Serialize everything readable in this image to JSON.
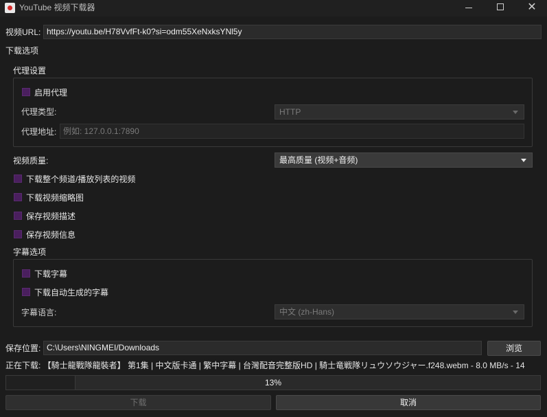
{
  "window": {
    "title": "YouTube 视频下载器"
  },
  "url": {
    "label": "视频URL:",
    "value": "https://youtu.be/H78VvfFt-k0?si=odm55XeNxksYNl5y"
  },
  "download_options": {
    "title": "下载选项",
    "proxy": {
      "title": "代理设置",
      "enable_label": "启用代理",
      "type_label": "代理类型:",
      "type_value": "HTTP",
      "address_label": "代理地址:",
      "address_placeholder": "例如: 127.0.0.1:7890"
    },
    "quality_label": "视频质量:",
    "quality_value": "最高质量 (视频+音频)",
    "checkboxes": {
      "channel": "下载整个频道/播放列表的视频",
      "thumbnail": "下载视频缩略图",
      "description": "保存视频描述",
      "info": "保存视频信息"
    },
    "subtitles": {
      "title": "字幕选项",
      "download_label": "下载字幕",
      "auto_label": "下载自动生成的字幕",
      "language_label": "字幕语言:",
      "language_value": "中文 (zh-Hans)"
    }
  },
  "save": {
    "label": "保存位置:",
    "value": "C:\\Users\\NINGMEI/Downloads",
    "browse_label": "浏览"
  },
  "status": {
    "text": "正在下载: 【騎士龍戰隊龍裝者】 第1集 | 中文版卡通 | 繁中字幕 | 台灣配音完整版HD | 騎士竜戦隊リュウソウジャー.f248.webm - 8.0 MB/s - 14"
  },
  "progress": {
    "value": 13,
    "label": "13%"
  },
  "actions": {
    "download_label": "下载",
    "cancel_label": "取消"
  },
  "colors": {
    "background": "#1c1c1c",
    "checkbox": "#4a1f5e"
  }
}
